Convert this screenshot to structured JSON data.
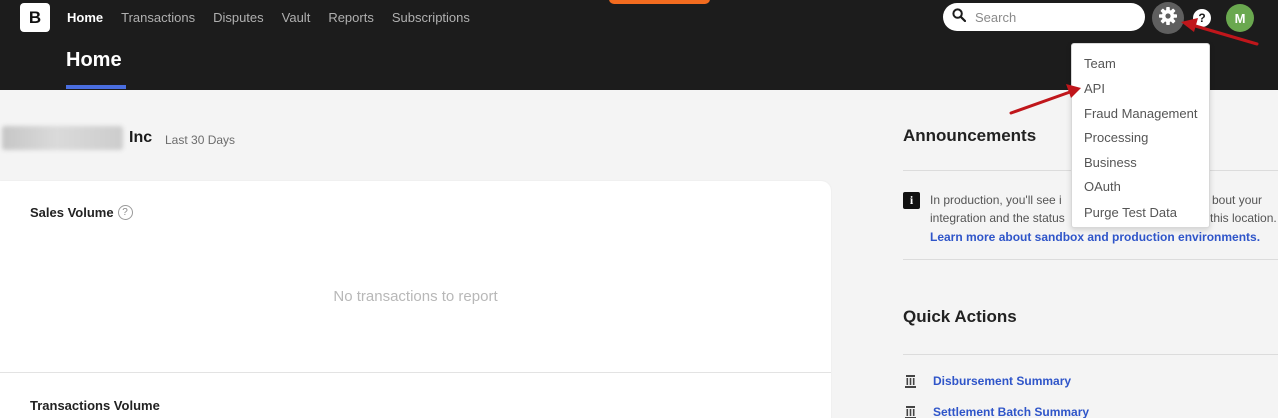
{
  "header": {
    "logo_letter": "B",
    "nav": [
      "Home",
      "Transactions",
      "Disputes",
      "Vault",
      "Reports",
      "Subscriptions"
    ],
    "active_nav": "Home",
    "search_placeholder": "Search",
    "help_label": "?",
    "avatar_initial": "M",
    "page_title": "Home"
  },
  "merchant": {
    "name_suffix": "Inc",
    "period": "Last 30 Days"
  },
  "sales_card": {
    "title": "Sales Volume",
    "info_label": "?",
    "empty_message": "No transactions to report"
  },
  "transactions_card": {
    "title": "Transactions Volume"
  },
  "announcements": {
    "heading": "Announcements",
    "info_letter": "i",
    "line1_left": "In production, you'll see i",
    "line1_right": "bout your",
    "line2_left": "integration and the status",
    "line2_right": "this location.",
    "link": "Learn more about sandbox and production environments."
  },
  "quick_actions": {
    "heading": "Quick Actions",
    "items": [
      {
        "label": "Disbursement Summary",
        "icon": "building-icon"
      },
      {
        "label": "Settlement Batch Summary",
        "icon": "building-icon"
      }
    ]
  },
  "settings_menu": {
    "items": [
      "Team",
      "API",
      "Fraud Management",
      "Processing",
      "Business",
      "OAuth",
      "Purge Test Data"
    ]
  },
  "colors": {
    "header_bg": "#1c1c1c",
    "accent_blue": "#4a6ee0",
    "link_blue": "#2f55c9",
    "env_badge": "#f26b1f",
    "avatar_bg": "#6aa84f",
    "annotation_arrow": "#c0161b"
  }
}
